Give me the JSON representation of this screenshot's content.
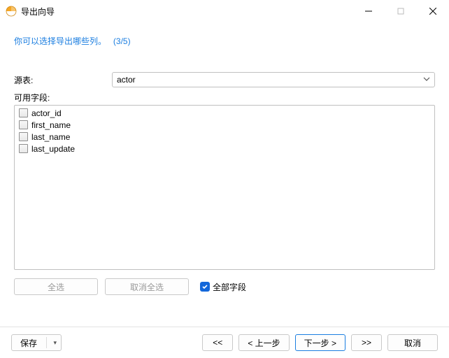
{
  "window": {
    "title": "导出向导"
  },
  "heading": {
    "text": "你可以选择导出哪些列。",
    "step": "(3/5)"
  },
  "sourceTable": {
    "label": "源表:",
    "value": "actor"
  },
  "fields": {
    "label": "可用字段:",
    "items": {
      "0": "actor_id",
      "1": "first_name",
      "2": "last_name",
      "3": "last_update"
    }
  },
  "buttons": {
    "selectAll": "全选",
    "deselectAll": "取消全选",
    "allFields": "全部字段"
  },
  "footer": {
    "save": "保存",
    "first": "<<",
    "prev": "< 上一步",
    "next": "下一步 >",
    "last": ">>",
    "cancel": "取消"
  }
}
